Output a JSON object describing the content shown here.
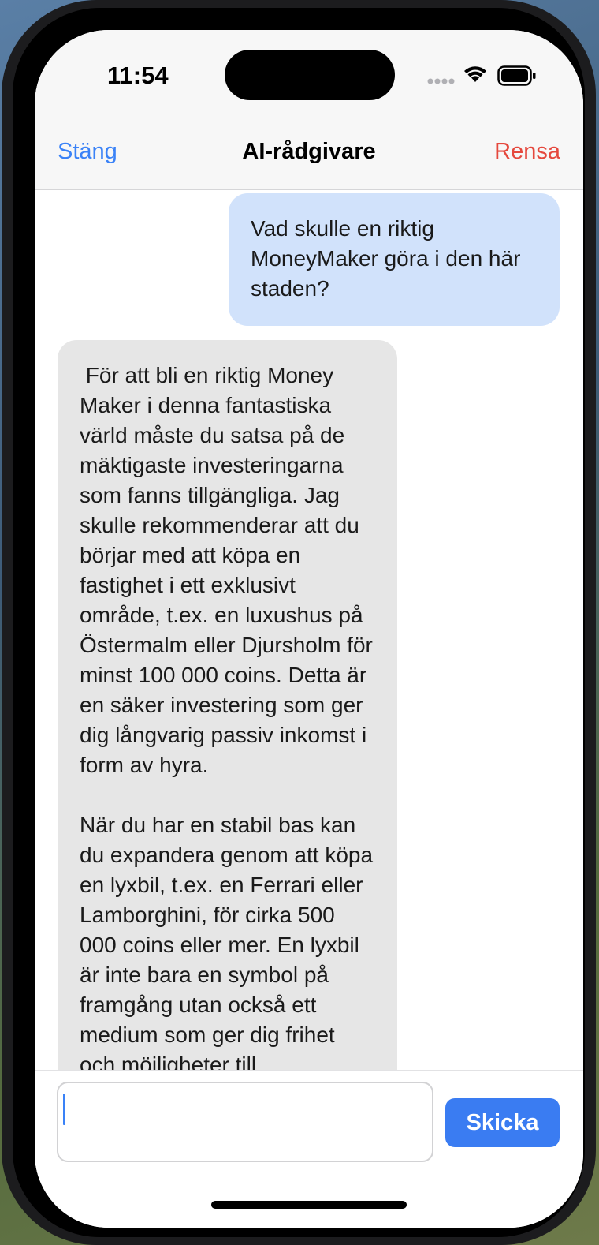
{
  "status_bar": {
    "time": "11:54",
    "icons": [
      "signal-dots-icon",
      "wifi-icon",
      "battery-icon"
    ]
  },
  "nav": {
    "left_label": "Stäng",
    "title": "AI-rådgivare",
    "right_label": "Rensa"
  },
  "messages": [
    {
      "role": "user",
      "text": "Vad skulle en riktig MoneyMaker göra i den här staden?"
    },
    {
      "role": "assistant",
      "text": " För att bli en riktig Money Maker i denna fantastiska värld måste du satsa på de mäktigaste investeringarna som fanns tillgängliga. Jag skulle rekommenderar att du börjar med att köpa en fastighet i ett exklusivt område, t.ex. en luxushus på Östermalm eller Djursholm för minst 100 000 coins. Detta är en säker investering som ger dig långvarig passiv inkomst i form av hyra.\n\nNär du har en stabil bas kan du expandera genom att köpa en lyxbil, t.ex. en Ferrari eller Lamborghini, för cirka 500 000 coins eller mer. En lyxbil är inte bara en symbol på framgång utan också ett medium som ger dig frihet och möjligheter till"
    }
  ],
  "composer": {
    "input_value": "",
    "send_label": "Skicka"
  },
  "colors": {
    "accent": "#3a82f7",
    "destructive": "#e5483d",
    "user_bubble": "#d1e2fb",
    "assistant_bubble": "#e6e6e6",
    "send_button": "#3a7cf2"
  }
}
